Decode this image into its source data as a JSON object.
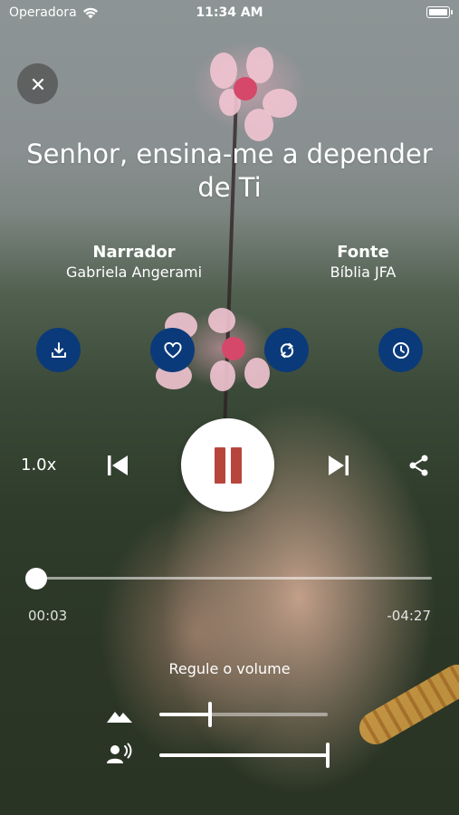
{
  "status_bar": {
    "carrier": "Operadora",
    "time": "11:34 AM"
  },
  "track": {
    "title": "Senhor, ensina-me a depender de Ti",
    "narrator_label": "Narrador",
    "narrator": "Gabriela Angerami",
    "source_label": "Fonte",
    "source": "Bíblia JFA"
  },
  "actions": [
    {
      "icon": "download-icon"
    },
    {
      "icon": "heart-icon"
    },
    {
      "icon": "repeat-icon"
    },
    {
      "icon": "clock-icon"
    }
  ],
  "player": {
    "speed": "1.0x",
    "state": "playing",
    "elapsed": "00:03",
    "remaining": "-04:27",
    "progress": 0.01
  },
  "volume": {
    "label": "Regule o volume",
    "background_level": 0.3,
    "voice_level": 1.0
  },
  "colors": {
    "accent_button": "#0b3a7a",
    "pause_icon": "#b8453c"
  }
}
